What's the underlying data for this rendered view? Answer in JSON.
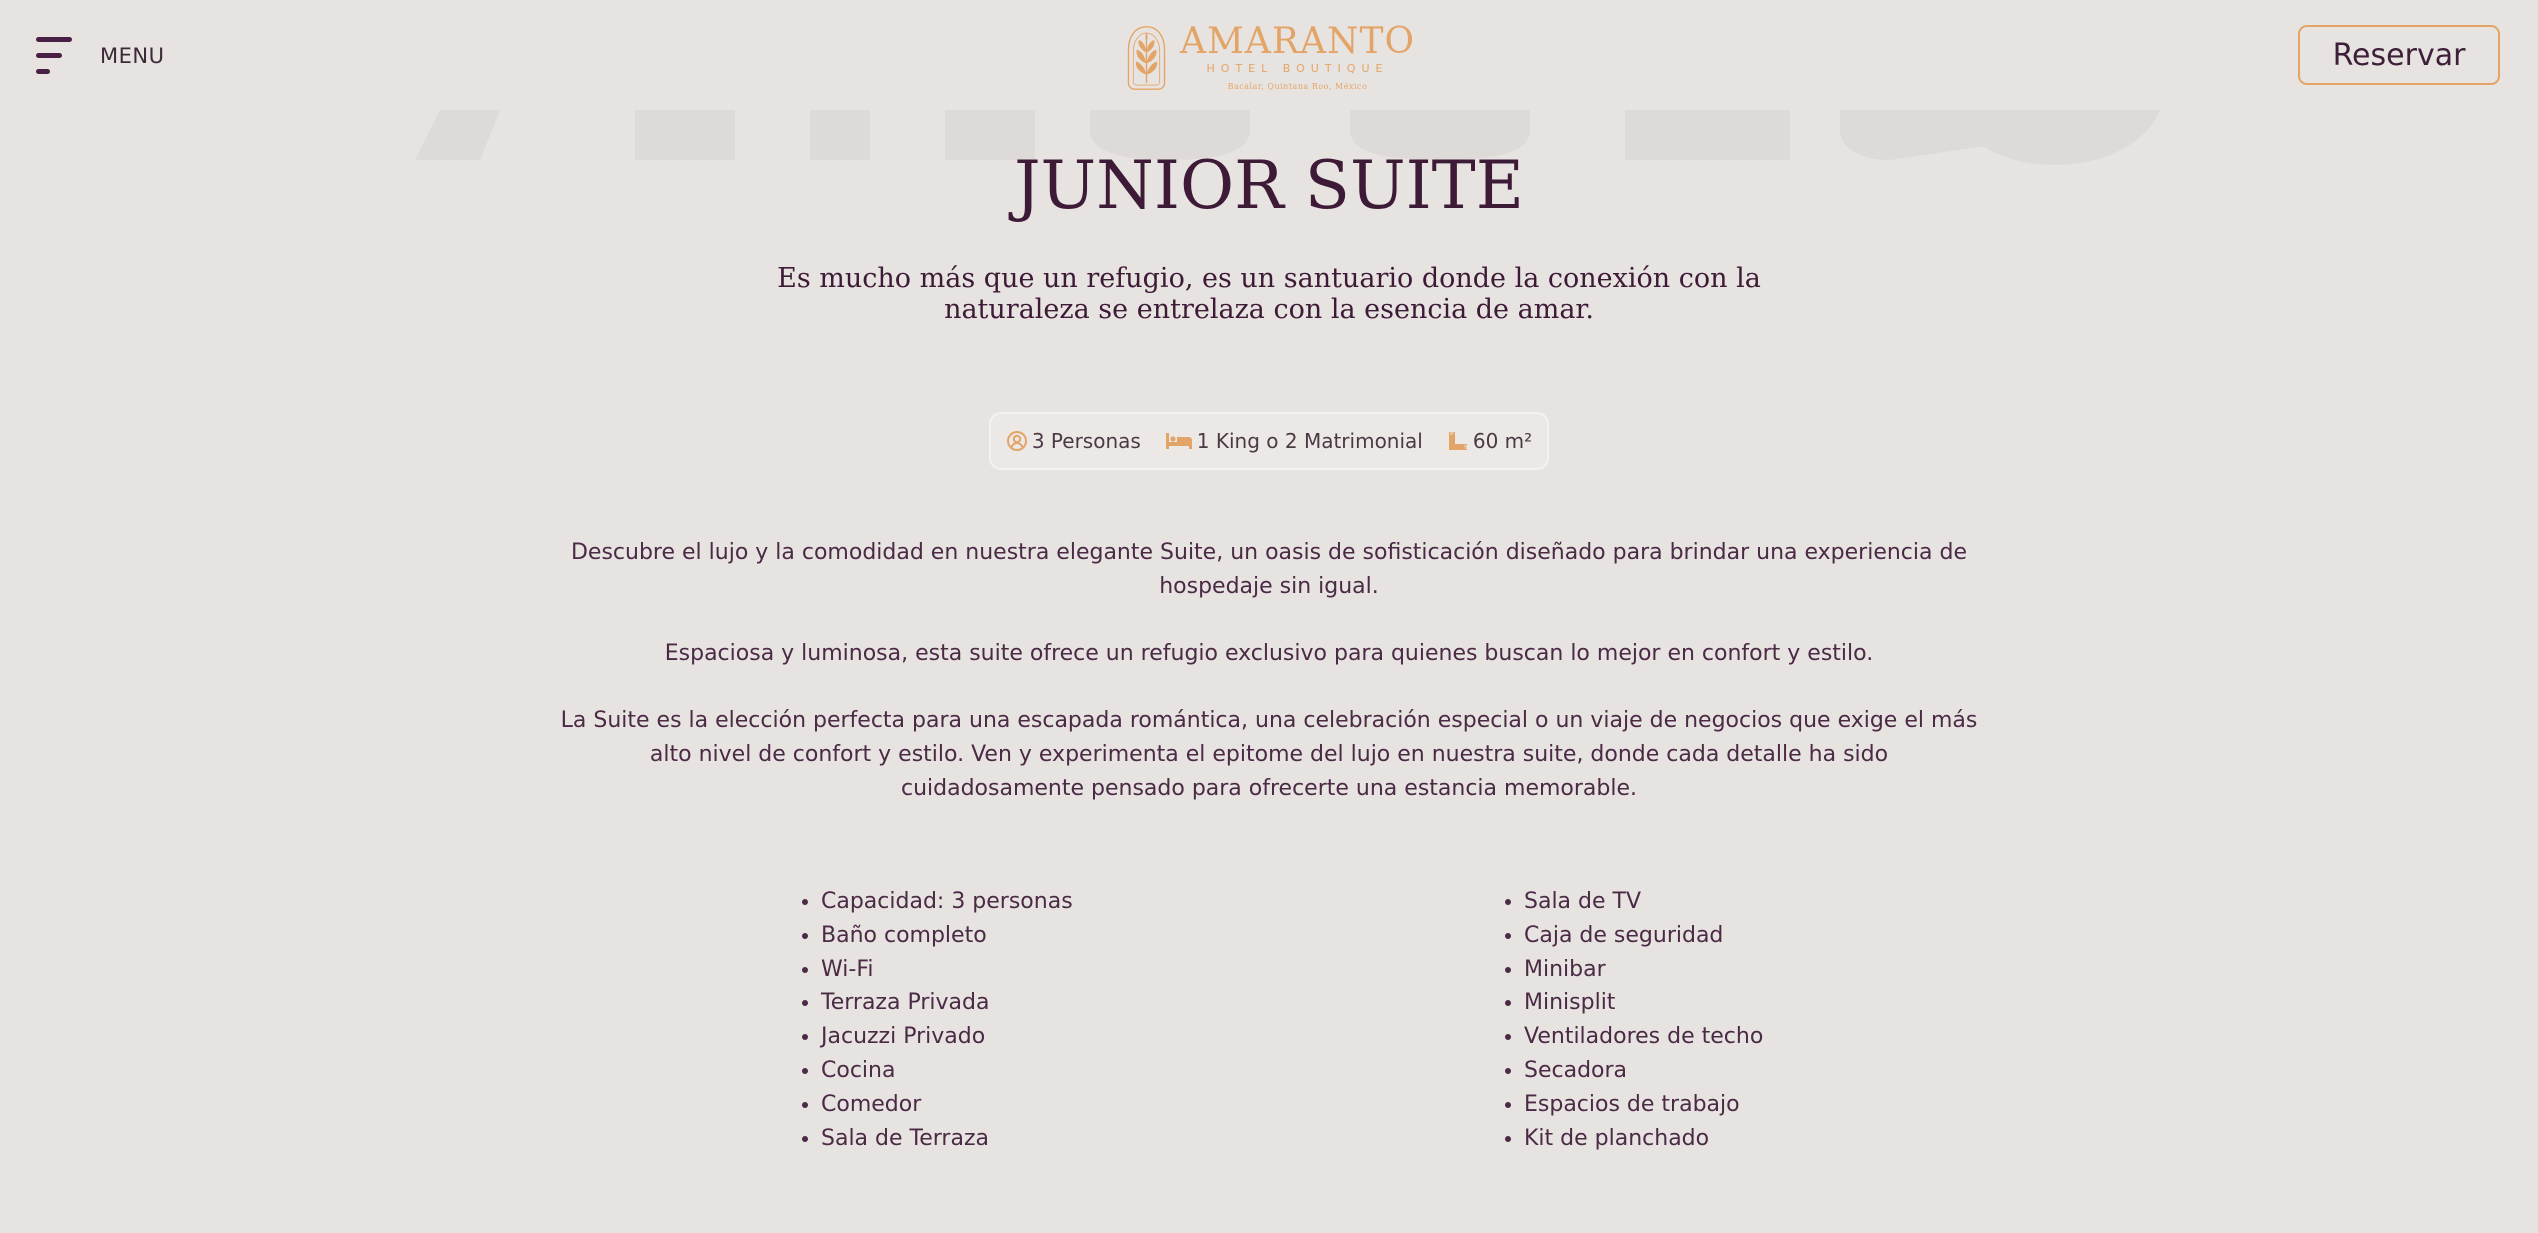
{
  "header": {
    "menu_label": "MENU",
    "logo": {
      "name": "AMARANTO",
      "subtitle": "HOTEL BOUTIQUE",
      "tagline": "Bacalar, Quintana Roo, México"
    },
    "reserve_label": "Reservar"
  },
  "colors": {
    "background": "#e7e3e1",
    "primary": "#3d1a36",
    "accent": "#e3a567"
  },
  "room": {
    "title": "JUNIOR SUITE",
    "subtitle": "Es mucho más que un refugio, es un santuario donde la conexión con la naturaleza se entrelaza con la esencia de amar.",
    "features": [
      {
        "icon": "person-icon",
        "label": "3 Personas"
      },
      {
        "icon": "bed-icon",
        "label": "1 King o 2 Matrimonial"
      },
      {
        "icon": "area-icon",
        "label": "60 m²"
      }
    ],
    "description": [
      "Descubre el lujo y la comodidad en nuestra elegante Suite, un oasis de sofisticación diseñado para brindar una experiencia de hospedaje sin igual.",
      "Espaciosa y luminosa, esta suite ofrece un refugio exclusivo para quienes buscan lo mejor en confort y estilo.",
      "La Suite es la elección perfecta para una escapada romántica, una celebración especial o un viaje de negocios que exige el más alto nivel de confort y estilo. Ven y experimenta el epitome del lujo en nuestra suite, donde cada detalle ha sido cuidadosamente pensado para ofrecerte una estancia memorable."
    ],
    "amenities_left": [
      "Capacidad: 3 personas",
      "Baño completo",
      "Wi-Fi",
      "Terraza Privada",
      "Jacuzzi Privado",
      "Cocina",
      "Comedor",
      "Sala de Terraza"
    ],
    "amenities_right": [
      "Sala de TV",
      "Caja de seguridad",
      "Minibar",
      "Minisplit",
      "Ventiladores de techo",
      "Secadora",
      "Espacios de trabajo",
      "Kit de planchado"
    ]
  }
}
